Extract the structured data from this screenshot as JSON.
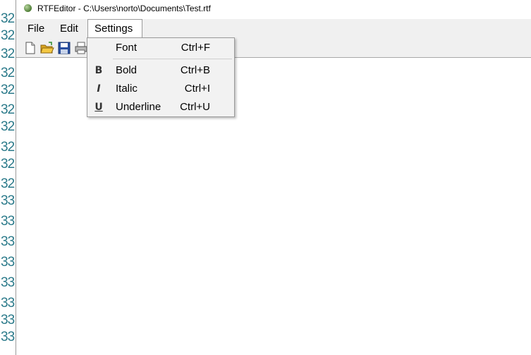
{
  "background_window": {
    "line_numbers": [
      "32",
      "32",
      "32",
      "32",
      "32",
      "32",
      "32",
      "32",
      "32",
      "32",
      "33",
      "33",
      "33",
      "33",
      "33",
      "33",
      "33",
      "33"
    ]
  },
  "window": {
    "title": "RTFEditor - C:\\Users\\norto\\Documents\\Test.rtf",
    "icon": "app-icon"
  },
  "menubar": {
    "items": [
      {
        "label": "File"
      },
      {
        "label": "Edit"
      },
      {
        "label": "Settings"
      }
    ]
  },
  "toolbar": {
    "buttons": [
      "new-document-icon",
      "open-folder-icon",
      "save-disk-icon",
      "print-icon"
    ]
  },
  "settings_menu": {
    "items": [
      {
        "label": "Font",
        "shortcut": "Ctrl+F",
        "icon": ""
      },
      {
        "label": "Bold",
        "shortcut": "Ctrl+B",
        "icon": "bold-icon",
        "glyph": "B"
      },
      {
        "label": "Italic",
        "shortcut": "Ctrl+I",
        "icon": "italic-icon",
        "glyph": "I"
      },
      {
        "label": "Underline",
        "shortcut": "Ctrl+U",
        "icon": "underline-icon",
        "glyph": "U"
      }
    ]
  },
  "colors": {
    "menubar_bg": "#f0f0f0",
    "line_number": "#2b7a8a"
  }
}
